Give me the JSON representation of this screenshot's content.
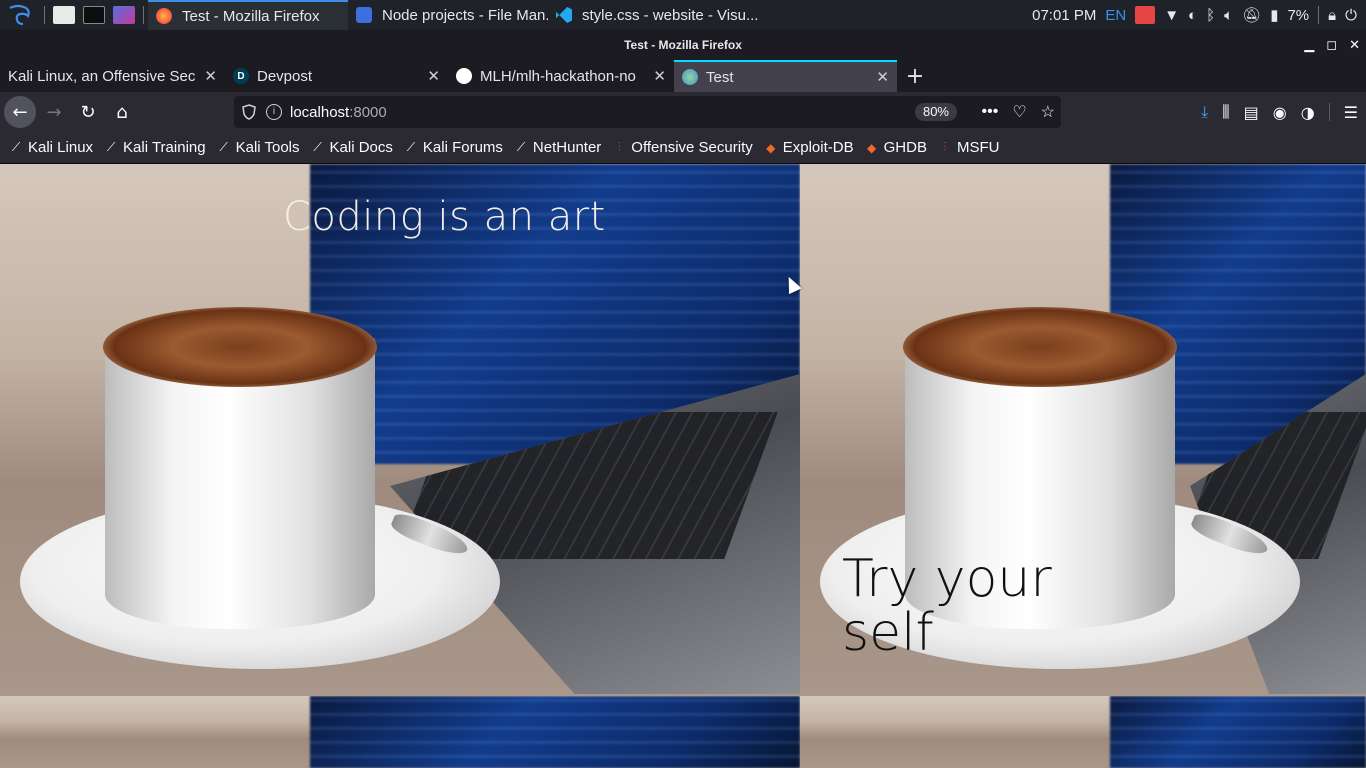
{
  "panel": {
    "tasks": [
      {
        "label": "Test - Mozilla Firefox",
        "icon": "firefox-icon",
        "active": true
      },
      {
        "label": "Node projects - File Man...",
        "icon": "folder-icon",
        "active": false
      },
      {
        "label": "style.css - website - Visu...",
        "icon": "vscode-icon",
        "active": false
      }
    ],
    "clock": "07:01 PM",
    "keyboard_layout": "EN",
    "battery": "7%"
  },
  "window": {
    "title": "Test - Mozilla Firefox"
  },
  "tabs": [
    {
      "label": "Kali Linux, an Offensive Secu",
      "favicon": "kali-icon",
      "selected": false
    },
    {
      "label": "Devpost",
      "favicon": "D",
      "selected": false
    },
    {
      "label": "MLH/mlh-hackathon-no",
      "favicon": "github-icon",
      "selected": false
    },
    {
      "label": "Test",
      "favicon": "globe-icon",
      "selected": true
    }
  ],
  "navbar": {
    "url_host": "localhost",
    "url_port": ":8000",
    "zoom": "80%"
  },
  "bookmarks": [
    {
      "label": "Kali Linux",
      "icon": "kali-dragon-icon"
    },
    {
      "label": "Kali Training",
      "icon": "kali-dragon-icon"
    },
    {
      "label": "Kali Tools",
      "icon": "kali-dragon-icon"
    },
    {
      "label": "Kali Docs",
      "icon": "kali-dragon-icon"
    },
    {
      "label": "Kali Forums",
      "icon": "kali-dragon-icon"
    },
    {
      "label": "NetHunter",
      "icon": "kali-dragon-icon"
    },
    {
      "label": "Offensive Security",
      "icon": "offsec-icon"
    },
    {
      "label": "Exploit-DB",
      "icon": "exploitdb-icon"
    },
    {
      "label": "GHDB",
      "icon": "exploitdb-icon"
    },
    {
      "label": "MSFU",
      "icon": "offsec-icon"
    }
  ],
  "page": {
    "headline": "Coding is an art",
    "tagline": "Try your self"
  },
  "colors": {
    "panel_bg": "#1f2329",
    "tab_accent": "#00ddff",
    "toolbar_bg": "#2b2a33",
    "headline_color": "#f3eee6",
    "tagline_color": "#111111"
  }
}
